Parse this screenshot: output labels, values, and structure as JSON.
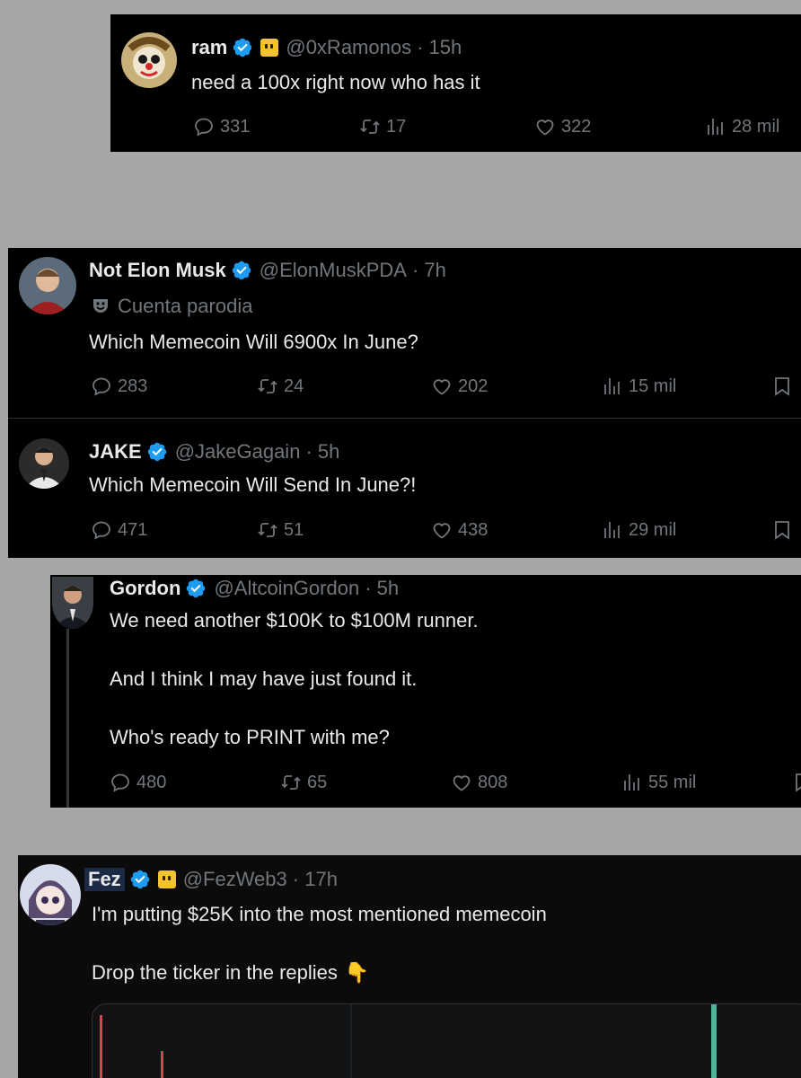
{
  "tweets": [
    {
      "name": "ram",
      "handle": "@0xRamonos",
      "time": "· 15h",
      "text": "need a 100x right now who has it",
      "replies": "331",
      "retweets": "17",
      "likes": "322",
      "views": "28 mil"
    },
    {
      "name": "Not Elon Musk",
      "handle": "@ElonMuskPDA",
      "time": "· 7h",
      "parody": "Cuenta parodia",
      "text": "Which Memecoin Will 6900x In June?",
      "replies": "283",
      "retweets": "24",
      "likes": "202",
      "views": "15 mil"
    },
    {
      "name": "JAKE",
      "handle": "@JakeGagain",
      "time": "· 5h",
      "text": "Which Memecoin Will Send In June?!",
      "replies": "471",
      "retweets": "51",
      "likes": "438",
      "views": "29 mil"
    },
    {
      "name": "Gordon",
      "handle": "@AltcoinGordon",
      "time": "· 5h",
      "lines": [
        "We need another $100K to $100M runner.",
        "And I think I may have just found it.",
        "Who's ready to PRINT with me?"
      ],
      "replies": "480",
      "retweets": "65",
      "likes": "808",
      "views": "55 mil"
    },
    {
      "name": "Fez",
      "handle": "@FezWeb3",
      "time": "· 17h",
      "lines": [
        "I'm putting $25K into the most mentioned memecoin",
        "Drop the ticker in the replies"
      ],
      "pointing_emoji": "👇"
    }
  ],
  "colors": {
    "verified": "#1d9bf0",
    "muted": "#71767b",
    "text": "#e7e9ea",
    "background": "#000000",
    "page": "#a6a6a6"
  }
}
